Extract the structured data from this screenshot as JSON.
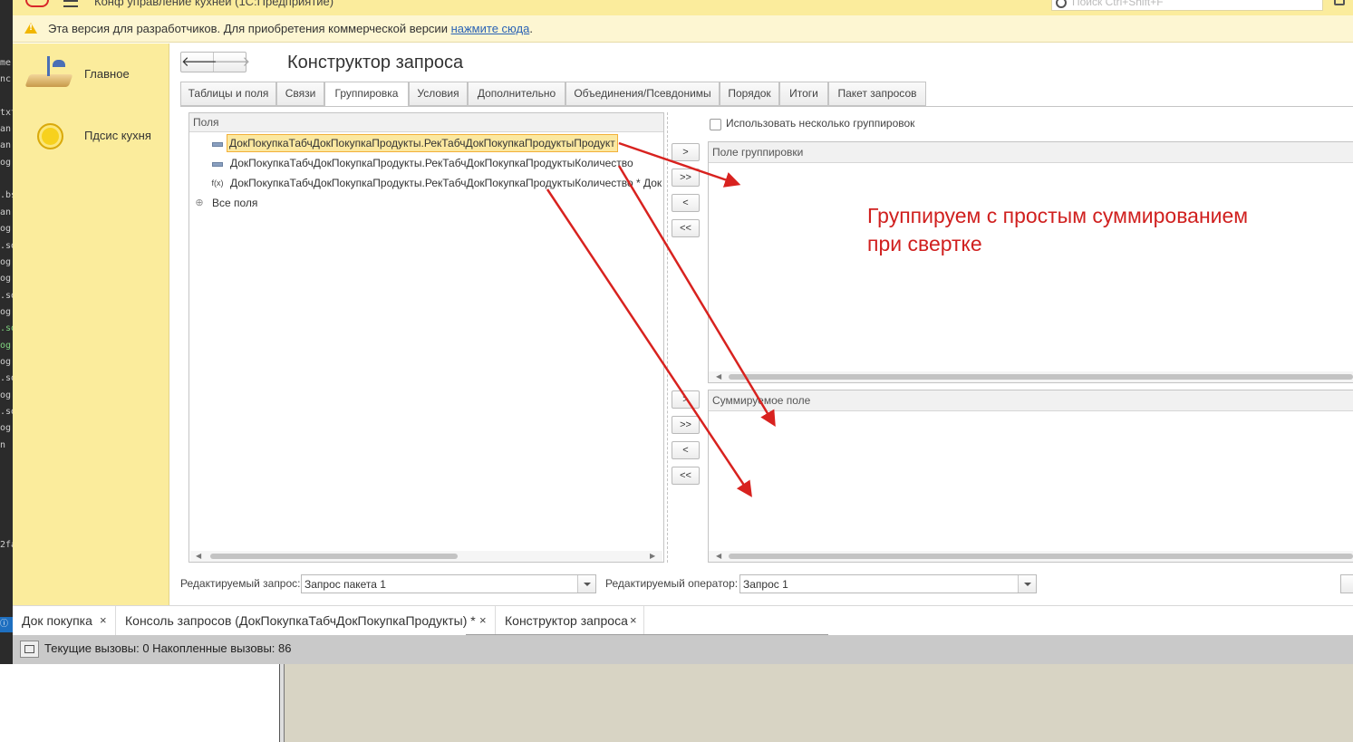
{
  "app": {
    "title": "Конф управление кухней (1С:Предприятие)",
    "search_placeholder": "Поиск Ctrl+Shift+F"
  },
  "warning": {
    "text": "Эта версия для разработчиков. Для приобретения коммерческой версии ",
    "link": "нажмите сюда",
    "suffix": "."
  },
  "sections": [
    {
      "label": "Главное",
      "icon": "desk-lamp-icon"
    },
    {
      "label": "Пдсис кухня",
      "icon": "yellow-circle-icon"
    }
  ],
  "form": {
    "title": "Конструктор запроса",
    "back": "🡐",
    "forward": "🡒"
  },
  "tabs": [
    {
      "label": "Таблицы и поля"
    },
    {
      "label": "Связи"
    },
    {
      "label": "Группировка"
    },
    {
      "label": "Условия"
    },
    {
      "label": "Дополнительно"
    },
    {
      "label": "Объединения/Псевдонимы"
    },
    {
      "label": "Порядок"
    },
    {
      "label": "Итоги"
    },
    {
      "label": "Пакет запросов"
    }
  ],
  "active_tab": "Группировка",
  "fields_panel": {
    "header": "Поля",
    "rows": [
      {
        "icon": "attribute-icon",
        "text": "ДокПокупкаТабчДокПокупкаПродукты.РекТабчДокПокупкаПродуктыПродукт",
        "selected": true
      },
      {
        "icon": "attribute-icon",
        "text": "ДокПокупкаТабчДокПокупкаПродукты.РекТабчДокПокупкаПродуктыКоличество",
        "selected": false
      },
      {
        "icon": "function-icon",
        "icon_text": "f(x)",
        "text": "ДокПокупкаТабчДокПокупкаПродукты.РекТабчДокПокупкаПродуктыКоличество * Док",
        "selected": false
      },
      {
        "icon": "expand-icon",
        "icon_text": "⊕",
        "text": "Все поля",
        "selected": false
      }
    ]
  },
  "move_buttons": {
    "add": ">",
    "add_all": ">>",
    "remove": "<",
    "remove_all": "<<"
  },
  "use_multiple_groupings": "Использовать несколько группировок",
  "grouping_field_header": "Поле группировки",
  "summed_field_header": "Суммируемое поле",
  "bottom": {
    "query_label": "Редактируемый запрос:",
    "query_value": "Запрос пакета 1",
    "operator_label": "Редактируемый оператор:",
    "operator_value": "Запрос 1"
  },
  "open_windows": [
    {
      "label": "Док покупка"
    },
    {
      "label": "Консоль запросов (ДокПокупкаТабчДокПокупкаПродукты) *"
    },
    {
      "label": "Конструктор запроса",
      "active": true
    }
  ],
  "close_glyph": "×",
  "status": {
    "text": "Текущие вызовы: 0   Накопленные вызовы: 86"
  },
  "annotation": {
    "line1": "Группируем с простым суммированием",
    "line2": "при свертке",
    "color": "#d0201f"
  },
  "background_code_fragments": [
    "me",
    "nc",
    "txt",
    "an",
    "an",
    "og",
    ".bs",
    "an",
    "og",
    ".sd",
    "og",
    "og",
    ".sd",
    "og",
    ".sd",
    "og",
    "og",
    ".sd",
    "og",
    ".sd",
    "og",
    "n",
    "2fa"
  ]
}
